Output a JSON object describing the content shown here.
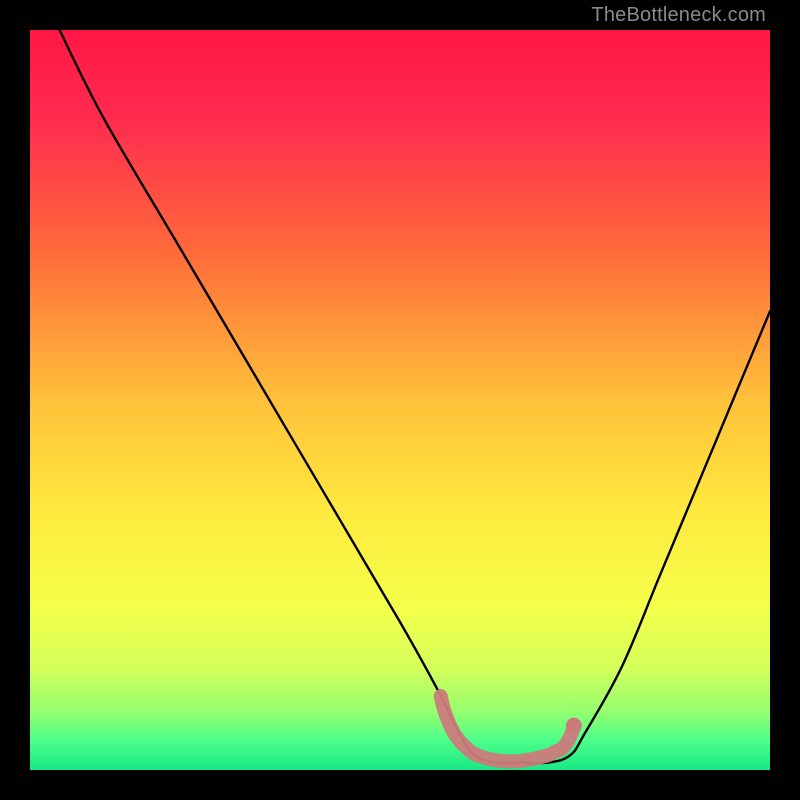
{
  "watermark": "TheBottleneck.com",
  "chart_data": {
    "type": "line",
    "title": "",
    "xlabel": "",
    "ylabel": "",
    "xlim": [
      0,
      100
    ],
    "ylim": [
      0,
      100
    ],
    "series": [
      {
        "name": "bottleneck-curve",
        "x": [
          4,
          10,
          20,
          30,
          40,
          50,
          55,
          58,
          60,
          63,
          66,
          70,
          73,
          75,
          80,
          85,
          90,
          95,
          100
        ],
        "values": [
          100,
          88,
          71,
          54,
          37,
          20,
          11,
          5,
          2,
          1,
          1,
          1,
          2,
          5,
          14,
          26,
          38,
          50,
          62
        ],
        "color": "#000000"
      }
    ],
    "highlight": {
      "name": "optimal-range",
      "color": "#cc7b7b",
      "x": [
        55.5,
        56,
        57,
        58,
        59,
        60,
        62,
        64,
        66,
        68,
        70,
        71,
        72,
        73,
        73.5
      ],
      "values": [
        10,
        8,
        5.5,
        4,
        3,
        2.2,
        1.5,
        1.2,
        1.2,
        1.5,
        2,
        2.5,
        3,
        4.5,
        6
      ]
    },
    "gradient_stops": [
      {
        "pct": 0,
        "color": "#ff1744"
      },
      {
        "pct": 12,
        "color": "#ff2b4f"
      },
      {
        "pct": 30,
        "color": "#ff6a3a"
      },
      {
        "pct": 50,
        "color": "#ffc13a"
      },
      {
        "pct": 65,
        "color": "#ffe93f"
      },
      {
        "pct": 78,
        "color": "#f4ff4a"
      },
      {
        "pct": 86,
        "color": "#d6ff5a"
      },
      {
        "pct": 92,
        "color": "#96ff6e"
      },
      {
        "pct": 96,
        "color": "#4dff8a"
      },
      {
        "pct": 100,
        "color": "#18e884"
      }
    ]
  }
}
